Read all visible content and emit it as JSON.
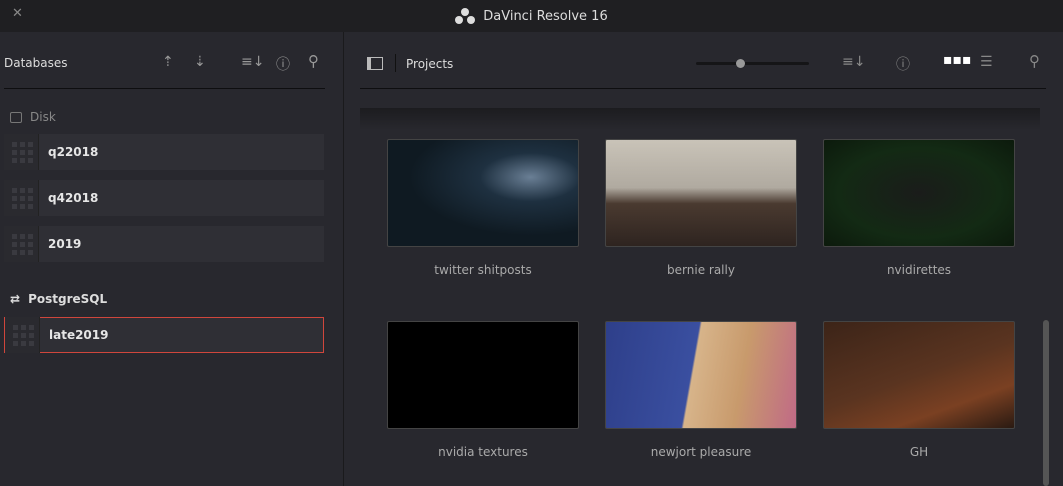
{
  "window": {
    "title": "DaVinci Resolve 16",
    "close": "✕"
  },
  "left": {
    "header": "Databases",
    "sections": [
      {
        "label": "Disk",
        "items": [
          "q22018",
          "q42018",
          "2019"
        ]
      },
      {
        "label": "PostgreSQL",
        "items": [
          "late2019"
        ]
      }
    ],
    "selected": "late2019"
  },
  "right": {
    "header": "Projects",
    "zoom_slider": 0.4,
    "view": "grid",
    "projects": [
      "twitter shitposts",
      "bernie rally",
      "nvidirettes",
      "nvidia textures",
      "newjort pleasure",
      "GH"
    ]
  },
  "colors": {
    "selection": "#d0463c"
  }
}
